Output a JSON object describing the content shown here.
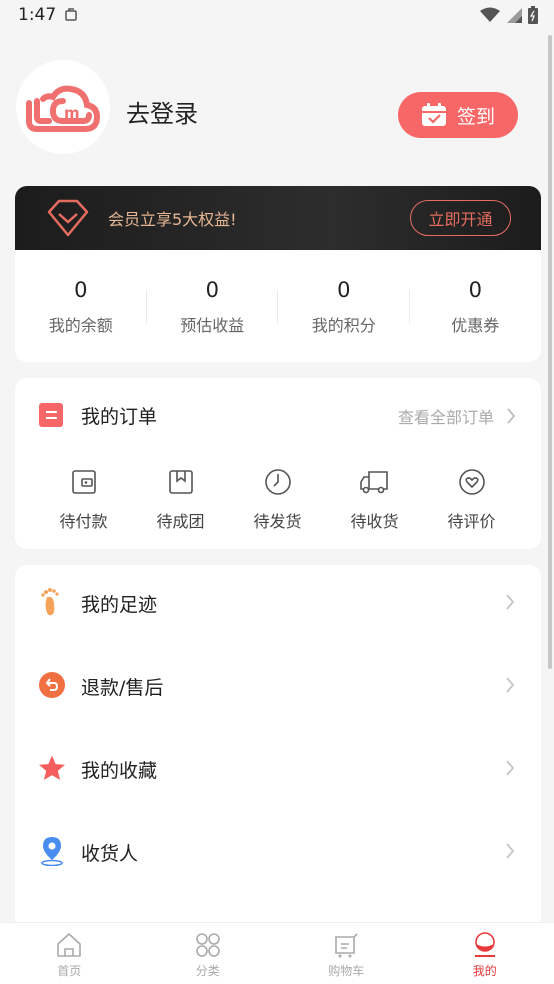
{
  "status_bar": {
    "time": "1:47"
  },
  "profile": {
    "login_text": "去登录",
    "signin_label": "签到",
    "logo_text": "m"
  },
  "member": {
    "promo_text": "会员立享5大权益!",
    "open_button": "立即开通",
    "stats": [
      {
        "value": "0",
        "label": "我的余额"
      },
      {
        "value": "0",
        "label": "预估收益"
      },
      {
        "value": "0",
        "label": "我的积分"
      },
      {
        "value": "0",
        "label": "优惠券"
      }
    ]
  },
  "orders": {
    "title": "我的订单",
    "view_all": "查看全部订单",
    "statuses": [
      {
        "label": "待付款",
        "icon": "wallet-icon"
      },
      {
        "label": "待成团",
        "icon": "bookmark-icon"
      },
      {
        "label": "待发货",
        "icon": "clock-icon"
      },
      {
        "label": "待收货",
        "icon": "truck-icon"
      },
      {
        "label": "待评价",
        "icon": "heart-icon"
      }
    ]
  },
  "menu": {
    "items": [
      {
        "label": "我的足迹",
        "icon": "footprint-icon"
      },
      {
        "label": "退款/售后",
        "icon": "refund-icon"
      },
      {
        "label": "我的收藏",
        "icon": "star-icon"
      },
      {
        "label": "收货人",
        "icon": "location-pin-icon"
      }
    ]
  },
  "tabbar": {
    "tabs": [
      {
        "label": "首页",
        "icon": "home-icon",
        "active": false
      },
      {
        "label": "分类",
        "icon": "grid-icon",
        "active": false
      },
      {
        "label": "购物车",
        "icon": "cart-icon",
        "active": false
      },
      {
        "label": "我的",
        "icon": "profile-icon",
        "active": true
      }
    ]
  },
  "colors": {
    "accent": "#f86767",
    "tab_active": "#e83a3a",
    "gold": "#e7b795"
  }
}
